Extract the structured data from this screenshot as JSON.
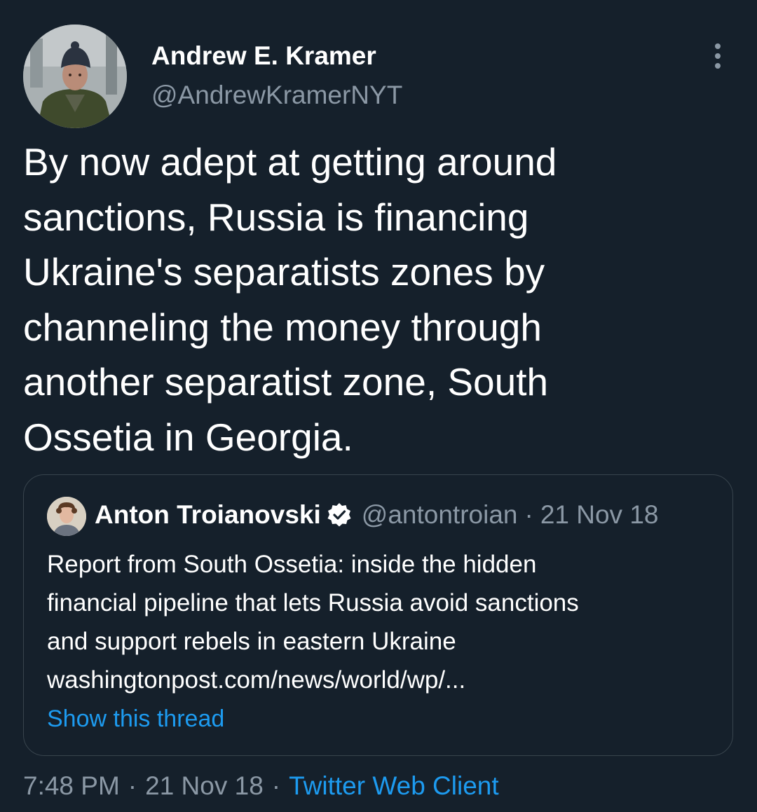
{
  "author": {
    "name": "Andrew E. Kramer",
    "handle": "@AndrewKramerNYT"
  },
  "tweet": {
    "text_lines": [
      "By now adept at getting around",
      "sanctions, Russia is financing",
      "Ukraine's separatists zones by",
      "channeling the money through",
      "another separatist zone, South",
      "Ossetia in Georgia."
    ]
  },
  "quoted": {
    "name": "Anton Troianovski",
    "handle": "@antontroian",
    "separator": "·",
    "date": "21 Nov 18",
    "text_lines": [
      "Report from South Ossetia: inside the hidden",
      "financial pipeline that lets Russia avoid sanctions",
      "and support rebels in eastern Ukraine",
      "washingtonpost.com/news/world/wp/..."
    ],
    "show_thread": "Show this thread"
  },
  "meta": {
    "time": "7:48 PM",
    "separator": "·",
    "date": "21 Nov 18",
    "source": "Twitter Web Client"
  },
  "icons": {
    "more": "more-vertical-icon",
    "verified": "verified-badge-icon"
  },
  "colors": {
    "background": "#15202b",
    "text": "#ffffff",
    "secondary_text": "#8b98a5",
    "link": "#1d9bf0",
    "border": "#38444d"
  }
}
